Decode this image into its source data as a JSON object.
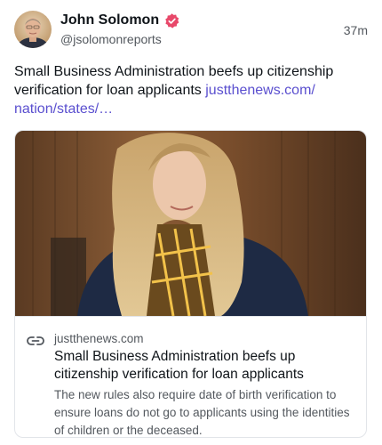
{
  "post": {
    "author": {
      "display_name": "John Solomon",
      "handle": "@jsolomonreports",
      "avatar_icon": "avatar-photo",
      "verified_icon": "verified-badge-icon",
      "verified_color": "#e8486a"
    },
    "timestamp": "37m",
    "text": "Small Business Administration beefs up citizenship verification for loan applicants ",
    "link_text": "justthenews.com/​nation/states/…",
    "link_color": "#5a4fcf"
  },
  "card": {
    "domain": "justthenews.com",
    "title": "Small Business Administration beefs up citizenship verification for loan applicants",
    "description": "The new rules also require date of birth verification to ensure loans do not go to applicants using the identities of children or the deceased.",
    "link_icon": "link-icon"
  }
}
